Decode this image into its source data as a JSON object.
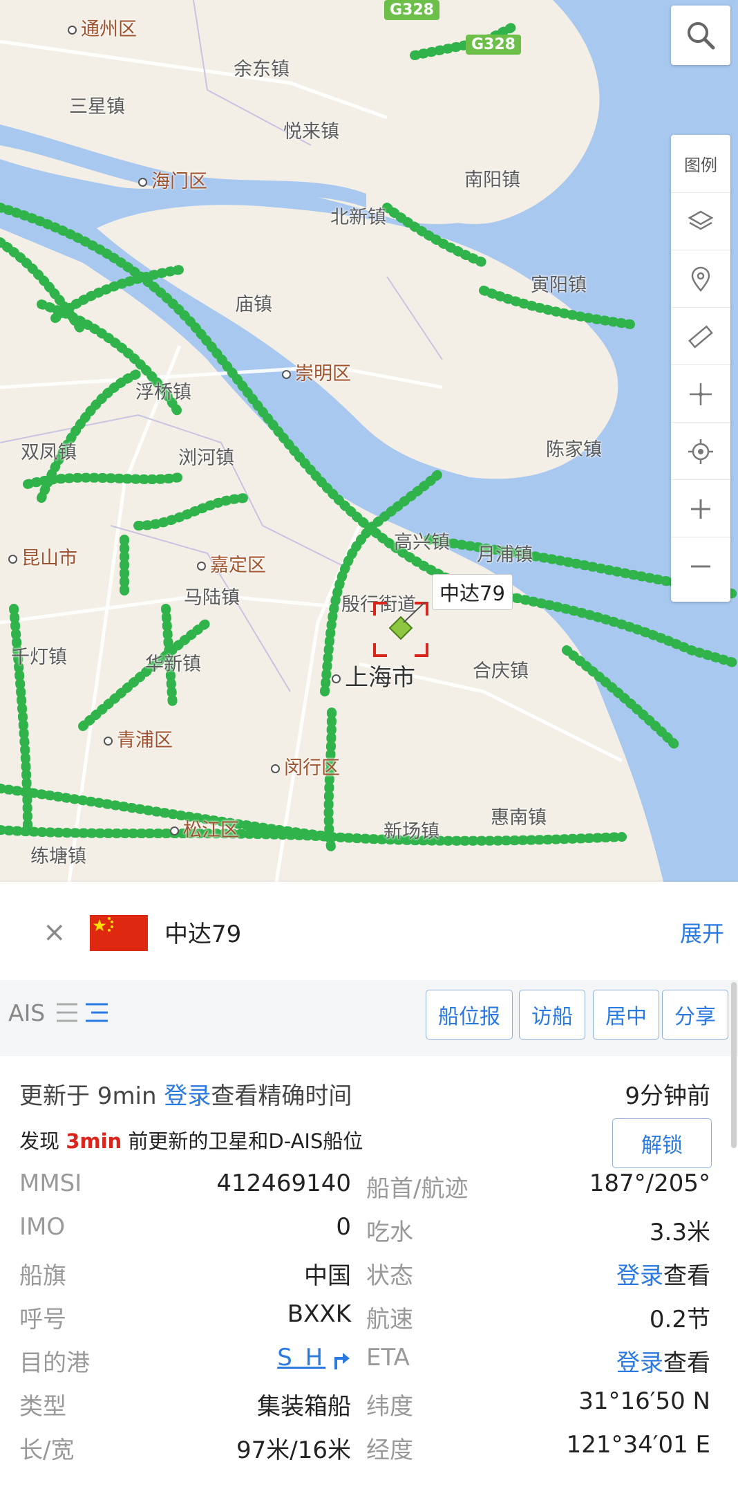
{
  "map": {
    "places": [
      {
        "id": "tongzhou",
        "name": "通州区",
        "city": true
      },
      {
        "id": "yudong",
        "name": "余东镇"
      },
      {
        "id": "sanxing",
        "name": "三星镇"
      },
      {
        "id": "yuelai",
        "name": "悦来镇"
      },
      {
        "id": "haimen",
        "name": "海门区",
        "city": true
      },
      {
        "id": "nanyang",
        "name": "南阳镇"
      },
      {
        "id": "beixin",
        "name": "北新镇"
      },
      {
        "id": "yinyang",
        "name": "寅阳镇"
      },
      {
        "id": "miaozhen",
        "name": "庙镇"
      },
      {
        "id": "chongming",
        "name": "崇明区",
        "city": true
      },
      {
        "id": "fuqiao",
        "name": "浮桥镇"
      },
      {
        "id": "shuangfeng",
        "name": "双凤镇"
      },
      {
        "id": "liuhe",
        "name": "浏河镇"
      },
      {
        "id": "chenjia",
        "name": "陈家镇"
      },
      {
        "id": "kunshan",
        "name": "昆山市",
        "city": true
      },
      {
        "id": "jiading",
        "name": "嘉定区",
        "city": true
      },
      {
        "id": "malu",
        "name": "马陆镇"
      },
      {
        "id": "gaoxing",
        "name": "高兴镇"
      },
      {
        "id": "yuexing",
        "name": "月浦镇"
      },
      {
        "id": "qiandeng",
        "name": "千灯镇"
      },
      {
        "id": "huaxin",
        "name": "华新镇"
      },
      {
        "id": "shanghai",
        "name": "上海市",
        "major": true
      },
      {
        "id": "heqing",
        "name": "合庆镇"
      },
      {
        "id": "qingpu",
        "name": "青浦区",
        "city": true
      },
      {
        "id": "minhang",
        "name": "闵行区",
        "city": true
      },
      {
        "id": "huinan",
        "name": "惠南镇"
      },
      {
        "id": "songjiang",
        "name": "松江区",
        "city": true
      },
      {
        "id": "xinyuan",
        "name": "新场镇"
      },
      {
        "id": "liantang",
        "name": "练塘镇"
      },
      {
        "id": "yanghang",
        "name": "殷行街道"
      }
    ],
    "road_shields": [
      "G328",
      "G328"
    ],
    "ship_label": "中达79",
    "colors": {
      "water": "#a8c8ef",
      "land": "#f3efe6",
      "track": "#2fb34a",
      "ship": "#8dc63f",
      "target": "#d9251c"
    }
  },
  "toolbar": {
    "search_icon": "search-icon",
    "legend_label": "图例",
    "items": [
      "layers-icon",
      "location-pin-icon",
      "ruler-icon",
      "crosshair-icon",
      "target-locate-icon",
      "zoom-in-icon",
      "zoom-out-icon"
    ]
  },
  "ship": {
    "name": "中达79",
    "flag": "china-flag",
    "expand_label": "展开",
    "close_label": "×"
  },
  "actions": {
    "ais_label": "AIS",
    "buttons": [
      "船位报",
      "访船",
      "居中",
      "分享"
    ]
  },
  "details": {
    "update_prefix": "更新于 9min ",
    "update_login": "登录",
    "update_suffix": "查看精确时间",
    "update_ago": "9分钟前",
    "sat_prefix": "发现 ",
    "sat_time": "3min",
    "sat_suffix": " 前更新的卫星和D-AIS船位",
    "unlock_label": "解锁",
    "rows": [
      {
        "k1": "MMSI",
        "v1": "412469140",
        "k2": "船首/航迹",
        "v2": "187°/205°"
      },
      {
        "k1": "IMO",
        "v1": "0",
        "k2": "吃水",
        "v2": "3.3米"
      },
      {
        "k1": "船旗",
        "v1": "中国",
        "k2": "状态",
        "v2_link": "登录",
        "v2": "查看"
      },
      {
        "k1": "呼号",
        "v1": "BXXK",
        "k2": "航速",
        "v2": "0.2节"
      },
      {
        "k1": "目的港",
        "v1_link": "S H",
        "k2": "ETA",
        "v2_link": "登录",
        "v2": "查看"
      },
      {
        "k1": "类型",
        "v1": "集装箱船",
        "k2": "纬度",
        "v2": "31°16′50 N"
      },
      {
        "k1": "长/宽",
        "v1": "97米/16米",
        "k2": "经度",
        "v2": "121°34′01 E"
      }
    ]
  }
}
